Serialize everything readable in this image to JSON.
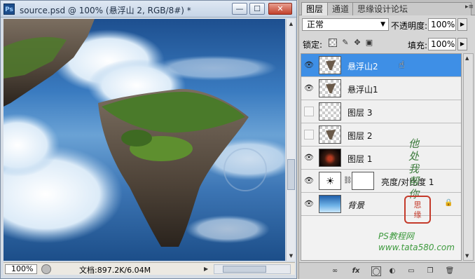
{
  "document": {
    "title": "source.psd @ 100% (悬浮山 2, RGB/8#) *",
    "app_icon": "Ps",
    "window_buttons": {
      "minimize": "—",
      "maximize": "☐",
      "close": "✕"
    },
    "zoom": "100%",
    "doc_info": "文档:897.2K/6.04M"
  },
  "layers_panel": {
    "tabs": [
      {
        "label": "图层",
        "active": true
      },
      {
        "label": "通道",
        "active": false
      },
      {
        "label": "思缘设计论坛",
        "active": false
      }
    ],
    "blend_mode": "正常",
    "opacity_label": "不透明度:",
    "opacity": "100%",
    "lock_label": "锁定:",
    "fill_label": "填充:",
    "fill": "100%",
    "layers": [
      {
        "name": "悬浮山2",
        "visible": true,
        "selected": true,
        "thumb": "rock"
      },
      {
        "name": "悬浮山1",
        "visible": true,
        "selected": false,
        "thumb": "rock"
      },
      {
        "name": "图层 3",
        "visible": false,
        "selected": false,
        "thumb": "empty"
      },
      {
        "name": "图层 2",
        "visible": false,
        "selected": false,
        "thumb": "rock"
      },
      {
        "name": "图层 1",
        "visible": true,
        "selected": false,
        "thumb": "dark"
      },
      {
        "name": "亮度/对比度 1",
        "visible": true,
        "selected": false,
        "thumb": "adjustment"
      },
      {
        "name": "背景",
        "visible": true,
        "selected": false,
        "thumb": "sky",
        "locked": true
      }
    ]
  },
  "watermark": {
    "handwriting": "他\n处\n我\n帮\n你",
    "stamp": "思\n缘",
    "site_line1": "PS教程网",
    "site_line2": "www.tata580.com"
  },
  "colors": {
    "selection": "#3e8fe6",
    "sky_dark": "#1c4e89",
    "close_button": "#c2412c"
  }
}
